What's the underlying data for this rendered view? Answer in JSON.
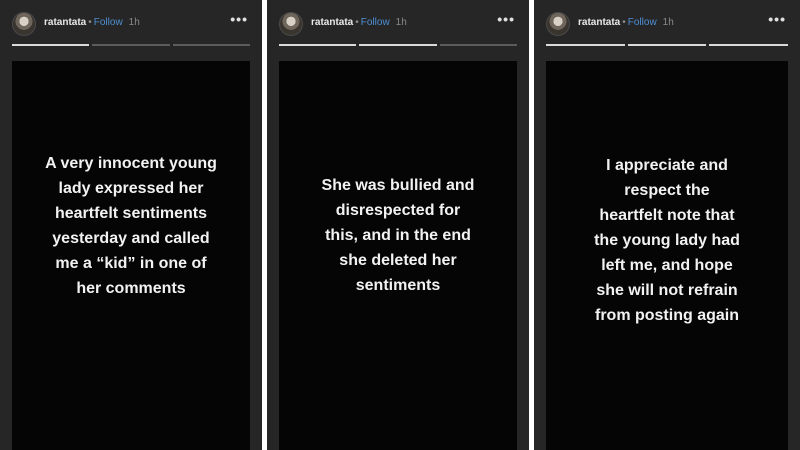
{
  "colors": {
    "panel_background": "#262626",
    "story_background": "#050505",
    "follow": "#4f8fd6",
    "separator": "#ffffff"
  },
  "panels": [
    {
      "username": "ratantata",
      "separator": "•",
      "follow_label": "Follow",
      "time": "1h",
      "more_icon": "more-horizontal-icon",
      "progress_done": [
        true,
        false,
        false
      ],
      "story_text": "A very innocent young\nlady expressed her\nheartfelt sentiments\nyesterday and called\nme a “kid” in one of\nher comments"
    },
    {
      "username": "ratantata",
      "separator": "•",
      "follow_label": "Follow",
      "time": "1h",
      "more_icon": "more-horizontal-icon",
      "progress_done": [
        true,
        true,
        false
      ],
      "story_text": "She was bullied and\ndisrespected for\nthis, and in the end\nshe deleted her\nsentiments"
    },
    {
      "username": "ratantata",
      "separator": "•",
      "follow_label": "Follow",
      "time": "1h",
      "more_icon": "more-horizontal-icon",
      "progress_done": [
        true,
        true,
        true
      ],
      "story_text": "I appreciate and\nrespect the\nheartfelt note that\nthe young lady had\nleft me, and hope\nshe will not refrain\nfrom posting again"
    }
  ]
}
